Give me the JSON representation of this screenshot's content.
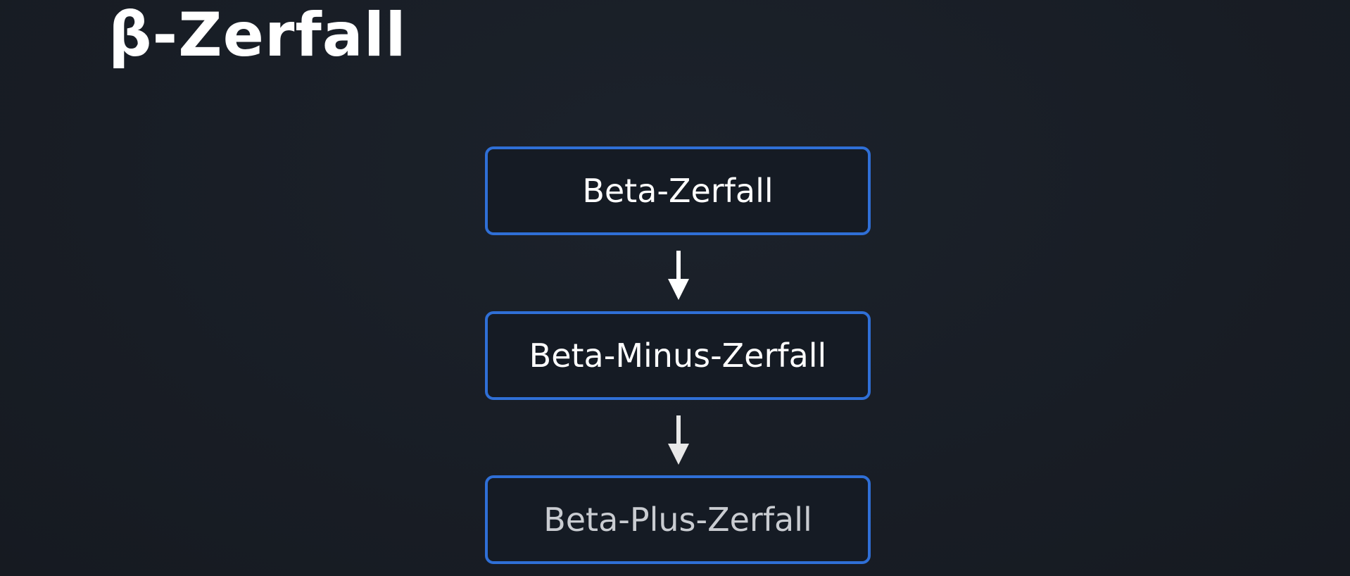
{
  "title": "β-Zerfall",
  "diagram": {
    "nodes": [
      {
        "id": "beta-zerfall",
        "label": "Beta-Zerfall"
      },
      {
        "id": "beta-minus-zerfall",
        "label": "Beta-Minus-Zerfall"
      },
      {
        "id": "beta-plus-zerfall",
        "label": "Beta-Plus-Zerfall"
      }
    ],
    "edges": [
      {
        "from": "beta-zerfall",
        "to": "beta-minus-zerfall"
      },
      {
        "from": "beta-minus-zerfall",
        "to": "beta-plus-zerfall"
      }
    ]
  },
  "colors": {
    "background": "#1a1f27",
    "box_border": "#2f6fd6",
    "text": "#ffffff",
    "text_dim": "#c9ccd1",
    "arrow": "#ffffff"
  }
}
